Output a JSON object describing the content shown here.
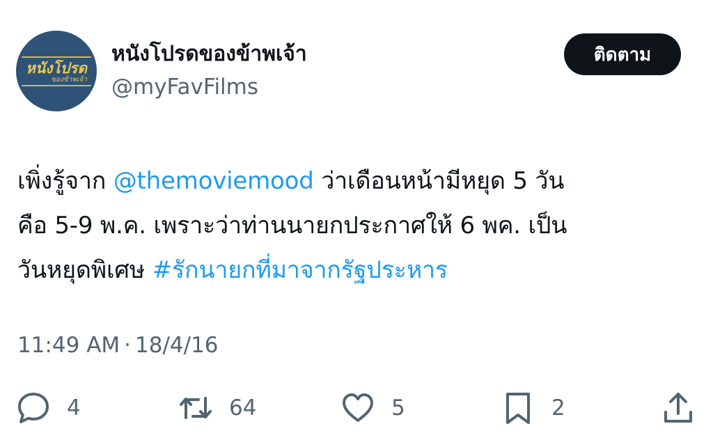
{
  "account": {
    "avatar_text_main": "หนังโปรด",
    "avatar_text_sub": "ของข้าพเจ้า",
    "display_name": "หนังโปรดของข้าพเจ้า",
    "handle": "@myFavFilms",
    "follow_label": "ติดตาม"
  },
  "tweet": {
    "lines": [
      [
        {
          "type": "text",
          "text": "เพิ่งรู้จาก "
        },
        {
          "type": "mention",
          "text": "@themoviemood"
        },
        {
          "type": "text",
          "text": " ว่าเดือนหน้ามีหยุด 5 วัน"
        }
      ],
      [
        {
          "type": "text",
          "text": "คือ 5-9 พ.ค. เพราะว่าท่านนายกประกาศให้ 6 พค. เป็น"
        }
      ],
      [
        {
          "type": "text",
          "text": "วันหยุดพิเศษ "
        },
        {
          "type": "hashtag",
          "text": "#รักนายกที่มาจากรัฐประหาร"
        }
      ]
    ],
    "time": "11:49 AM",
    "separator": "·",
    "date": "18/4/16"
  },
  "actions": {
    "reply_count": "4",
    "retweet_count": "64",
    "like_count": "5",
    "bookmark_count": "2"
  },
  "colors": {
    "link": "#1d9bf0",
    "text": "#0f1419",
    "secondary": "#536471",
    "avatar_bg": "#2f5377",
    "avatar_gold": "#e9c755"
  },
  "icons": [
    "reply-icon",
    "retweet-icon",
    "like-icon",
    "bookmark-icon",
    "share-icon"
  ]
}
